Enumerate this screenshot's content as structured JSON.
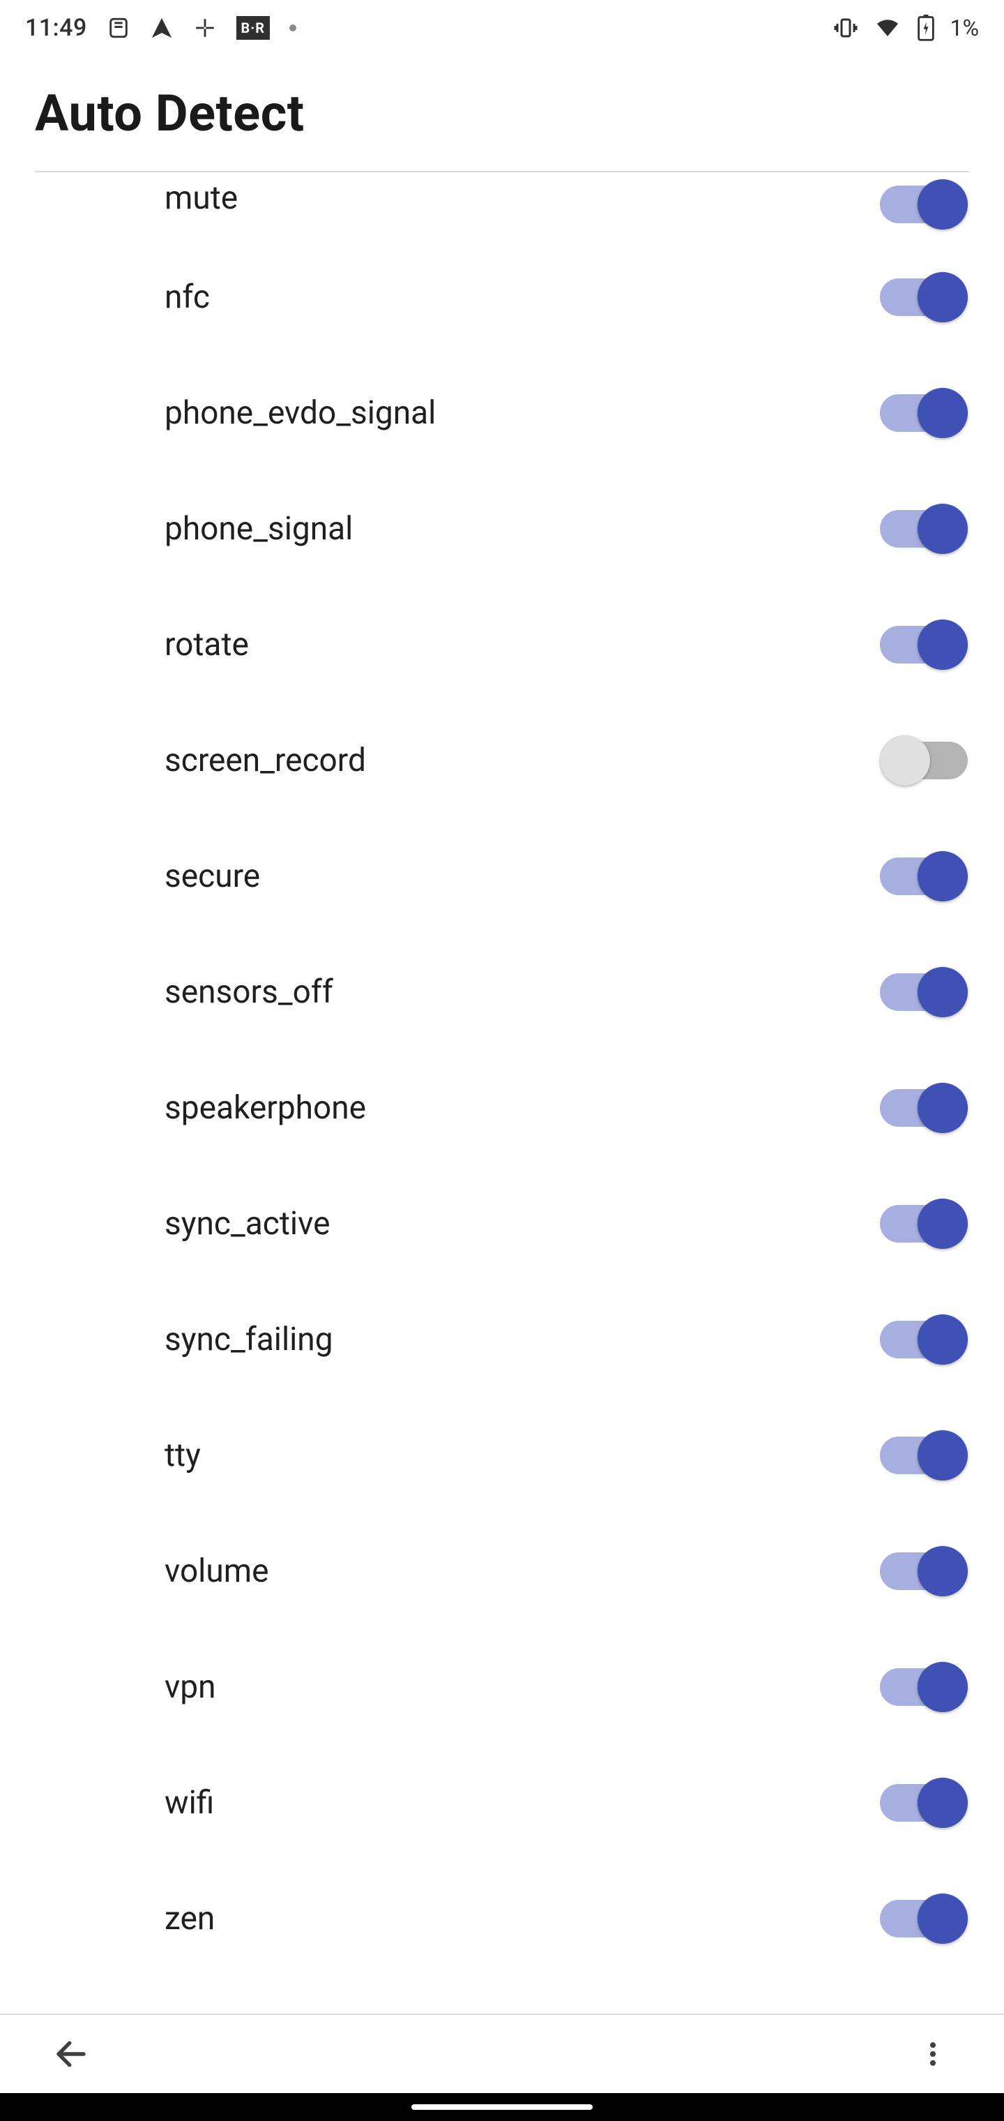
{
  "status_bar": {
    "clock": "11:49",
    "battery_text": "1%"
  },
  "header": {
    "title": "Auto Detect"
  },
  "settings": [
    {
      "label": "mute",
      "on": true
    },
    {
      "label": "nfc",
      "on": true
    },
    {
      "label": "phone_evdo_signal",
      "on": true
    },
    {
      "label": "phone_signal",
      "on": true
    },
    {
      "label": "rotate",
      "on": true
    },
    {
      "label": "screen_record",
      "on": false
    },
    {
      "label": "secure",
      "on": true
    },
    {
      "label": "sensors_off",
      "on": true
    },
    {
      "label": "speakerphone",
      "on": true
    },
    {
      "label": "sync_active",
      "on": true
    },
    {
      "label": "sync_failing",
      "on": true
    },
    {
      "label": "tty",
      "on": true
    },
    {
      "label": "volume",
      "on": true
    },
    {
      "label": "vpn",
      "on": true
    },
    {
      "label": "wifi",
      "on": true
    },
    {
      "label": "zen",
      "on": true
    }
  ]
}
